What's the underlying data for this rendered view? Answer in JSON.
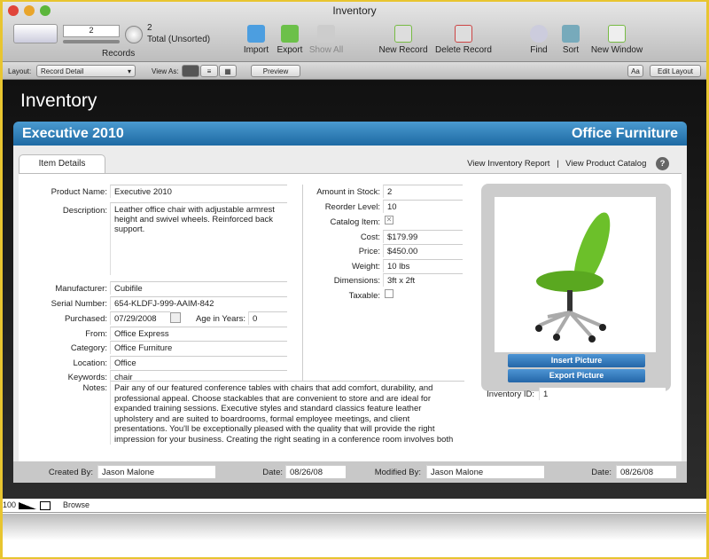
{
  "window": {
    "title": "Inventory"
  },
  "toolbar": {
    "record_number": "2",
    "records_label": "Records",
    "total_count": "2",
    "total_status": "Total (Unsorted)",
    "buttons": [
      {
        "label": "Import",
        "icon": "import-icon"
      },
      {
        "label": "Export",
        "icon": "export-icon"
      },
      {
        "label": "Show All",
        "icon": "show-all-icon"
      },
      {
        "label": "New Record",
        "icon": "new-record-icon"
      },
      {
        "label": "Delete Record",
        "icon": "delete-record-icon"
      },
      {
        "label": "Find",
        "icon": "find-icon"
      },
      {
        "label": "Sort",
        "icon": "sort-icon"
      },
      {
        "label": "New Window",
        "icon": "new-window-icon"
      }
    ]
  },
  "layoutbar": {
    "layout_label": "Layout:",
    "layout_value": "Record Detail",
    "view_as_label": "View As:",
    "preview": "Preview",
    "text_format": "Aa",
    "edit_layout": "Edit Layout"
  },
  "header": {
    "title": "Inventory",
    "record_name": "Executive 2010",
    "category": "Office Furniture"
  },
  "tabs": {
    "item_details": "Item Details"
  },
  "links": {
    "report": "View Inventory Report",
    "separator": "|",
    "catalog": "View Product Catalog",
    "help": "?"
  },
  "left_fields": {
    "product_name": {
      "label": "Product Name:",
      "value": "Executive 2010"
    },
    "description": {
      "label": "Description:",
      "value": "Leather office chair with adjustable armrest height and swivel wheels. Reinforced back support."
    },
    "manufacturer": {
      "label": "Manufacturer:",
      "value": "Cubifile"
    },
    "serial": {
      "label": "Serial Number:",
      "value": "654-KLDFJ-999-AAIM-842"
    },
    "purchased": {
      "label": "Purchased:",
      "value": "07/29/2008"
    },
    "age": {
      "label": "Age in Years:",
      "value": "0"
    },
    "from": {
      "label": "From:",
      "value": "Office Express"
    },
    "category": {
      "label": "Category:",
      "value": "Office Furniture"
    },
    "location": {
      "label": "Location:",
      "value": "Office"
    },
    "keywords": {
      "label": "Keywords:",
      "value": "chair"
    }
  },
  "right_fields": {
    "stock": {
      "label": "Amount in Stock:",
      "value": "2"
    },
    "reorder": {
      "label": "Reorder Level:",
      "value": "10"
    },
    "catalog_item": {
      "label": "Catalog Item:",
      "checked": true
    },
    "cost": {
      "label": "Cost:",
      "value": "$179.99"
    },
    "price": {
      "label": "Price:",
      "value": "$450.00"
    },
    "weight": {
      "label": "Weight:",
      "value": "10 lbs"
    },
    "dimensions": {
      "label": "Dimensions:",
      "value": "3ft x 2ft"
    },
    "taxable": {
      "label": "Taxable:",
      "checked": false
    }
  },
  "notes": {
    "label": "Notes:",
    "value": "Pair any of our featured conference tables with chairs that add comfort, durability, and professional appeal. Choose stackables that are convenient to store and are ideal for expanded training sessions. Executive styles and standard classics feature leather upholstery and are suited to boardrooms, formal employee meetings, and client presentations. You'll be exceptionally pleased with the quality that will provide the right impression for your business. Creating the right seating in a conference room involves both"
  },
  "picture": {
    "insert": "Insert Picture",
    "export": "Export Picture",
    "chair_color": "#6cc02a"
  },
  "inventory_id": {
    "label": "Inventory ID:",
    "value": "1"
  },
  "footer": {
    "created_by_label": "Created By:",
    "created_by": "Jason Malone",
    "date_label": "Date:",
    "created_date": "08/26/08",
    "modified_by_label": "Modified By:",
    "modified_by": "Jason Malone",
    "modified_date": "08/26/08"
  },
  "status": {
    "zoom": "100",
    "mode": "Browse"
  }
}
